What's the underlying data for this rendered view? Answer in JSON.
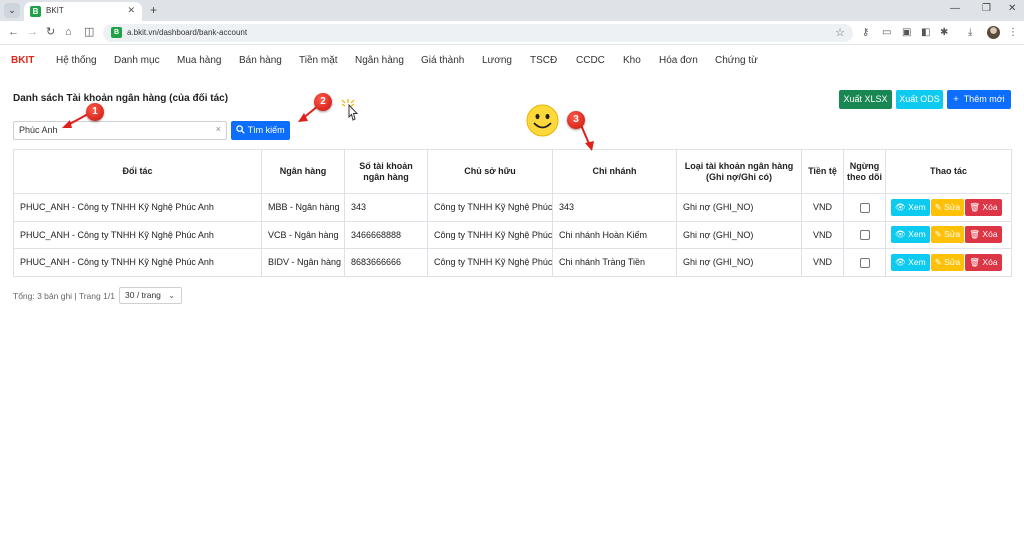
{
  "browser": {
    "tab_title": "BKIT",
    "favicon_letter": "B",
    "url": "a.bkit.vn/dashboard/bank-account"
  },
  "navbar": {
    "brand": "BKIT",
    "items": [
      "Hệ thống",
      "Danh mục",
      "Mua hàng",
      "Bán hàng",
      "Tiền mặt",
      "Ngân hàng",
      "Giá thành",
      "Lương",
      "TSCĐ",
      "CCDC",
      "Kho",
      "Hóa đơn",
      "Chứng từ"
    ]
  },
  "page": {
    "title": "Danh sách Tài khoản ngân hàng (của đối tác)",
    "export_xlsx": "Xuất XLSX",
    "export_ods": "Xuất ODS",
    "add_new": "Thêm mới",
    "search_value": "Phúc Anh",
    "search_button": "Tìm kiếm"
  },
  "table": {
    "headers": [
      "Đối tác",
      "Ngân hàng",
      "Số tài khoản ngân hàng",
      "Chủ sở hữu",
      "Chi nhánh",
      "Loại tài khoản ngân hàng (Ghi nợ/Ghi có)",
      "Tiền tệ",
      "Ngừng theo dõi",
      "Thao tác"
    ],
    "rows": [
      {
        "partner": "PHUC_ANH - Công ty TNHH Kỹ Nghệ Phúc Anh",
        "bank": "MBB - Ngân hàng",
        "account": "343",
        "owner": "Công ty TNHH Kỹ Nghệ Phúc Anh",
        "branch": "343",
        "type": "Ghi nợ (GHI_NO)",
        "currency": "VND",
        "stopped": false
      },
      {
        "partner": "PHUC_ANH - Công ty TNHH Kỹ Nghệ Phúc Anh",
        "bank": "VCB - Ngân hàng",
        "account": "3466668888",
        "owner": "Công ty TNHH Kỹ Nghệ Phúc Anh",
        "branch": "Chi nhánh Hoàn Kiếm",
        "type": "Ghi nợ (GHI_NO)",
        "currency": "VND",
        "stopped": false
      },
      {
        "partner": "PHUC_ANH - Công ty TNHH Kỹ Nghệ Phúc Anh",
        "bank": "BIDV - Ngân hàng",
        "account": "8683666666",
        "owner": "Công ty TNHH Kỹ Nghệ Phúc Anh",
        "branch": "Chi nhánh Tràng Tiền",
        "type": "Ghi nợ (GHI_NO)",
        "currency": "VND",
        "stopped": false
      }
    ],
    "action_view": "Xem",
    "action_edit": "Sửa",
    "action_delete": "Xóa"
  },
  "footer": {
    "summary": "Tổng: 3 bản ghi | Trang 1/1",
    "page_size": "30 / trang"
  },
  "annotations": {
    "markers": [
      "1",
      "2",
      "3"
    ],
    "marker_color": "#e0201a"
  }
}
